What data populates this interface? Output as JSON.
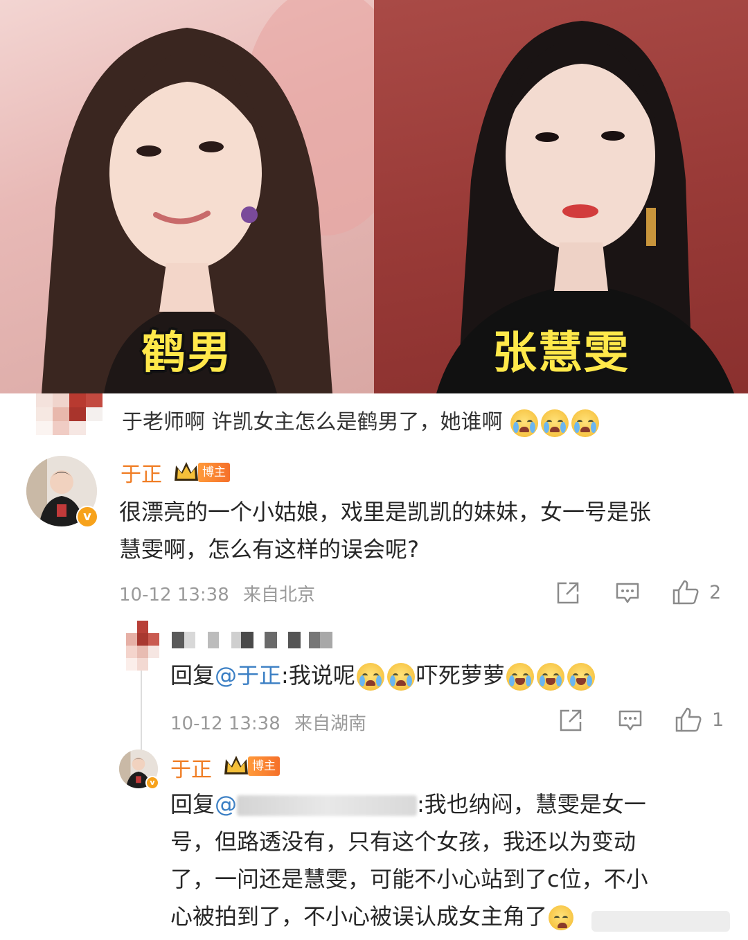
{
  "photos": {
    "left_caption": "鹤男",
    "right_caption": "张慧雯"
  },
  "top_comment": {
    "text": "于老师啊 许凯女主怎么是鹤男了，她谁啊",
    "emojis": [
      "crying-face",
      "crying-face",
      "crying-face"
    ]
  },
  "main_comment": {
    "username": "于正",
    "badge": "博主",
    "text_line1": "很漂亮的一个小姑娘，戏里是凯凯的妹妹，女一号是张",
    "text_line2": "慧雯啊，怎么有这样的误会呢?",
    "timestamp": "10-12 13:38",
    "location": "来自北京",
    "likes": "2"
  },
  "reply_1": {
    "prefix": "回复",
    "mention": "@于正",
    "text_a": ":我说呢",
    "text_b": "吓死萝萝",
    "timestamp": "10-12 13:38",
    "location": "来自湖南",
    "likes": "1"
  },
  "reply_2": {
    "username": "于正",
    "badge": "博主",
    "prefix": "回复",
    "mention": "@",
    "text_line1": ":我也纳闷，慧雯是女一",
    "text_line2": "号，但路透没有，只有这个女孩，我还以为变动",
    "text_line3": "了，一问还是慧雯，可能不小心站到了c位，不小",
    "text_line4": "心被拍到了，不小心被误认成女主角了"
  },
  "colors": {
    "username": "#f07d24",
    "mention": "#3b7fc4",
    "meta": "#9a9a9a",
    "caption": "#ffe84a"
  }
}
